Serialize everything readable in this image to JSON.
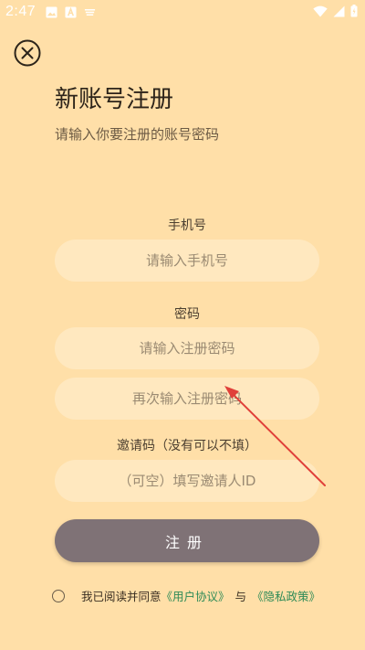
{
  "status_bar": {
    "time": "2:47",
    "icons": [
      "image-icon",
      "a-box-icon",
      "cast-icon",
      "wifi-icon",
      "signal-icon",
      "battery-icon"
    ]
  },
  "header": {
    "close_icon": "close-circle-icon",
    "title": "新账号注册",
    "subtitle": "请输入你要注册的账号密码"
  },
  "form": {
    "phone_label": "手机号",
    "phone_placeholder": "请输入手机号",
    "password_label": "密码",
    "password_placeholder": "请输入注册密码",
    "password_confirm_placeholder": "再次输入注册密码",
    "invite_label": "邀请码（没有可以不填）",
    "invite_placeholder": "（可空）填写邀请人ID",
    "submit_label": "注册"
  },
  "agreement": {
    "prefix": "我已阅读并同意",
    "user_agreement": "《用户协议》",
    "joiner": "与",
    "privacy_policy": "《隐私政策》"
  },
  "colors": {
    "background": "#FFDFA8",
    "field_bg": "#FFE8BF",
    "button_bg": "#7F7276",
    "link": "#2E8B57",
    "annotation_arrow": "#E0403A"
  }
}
